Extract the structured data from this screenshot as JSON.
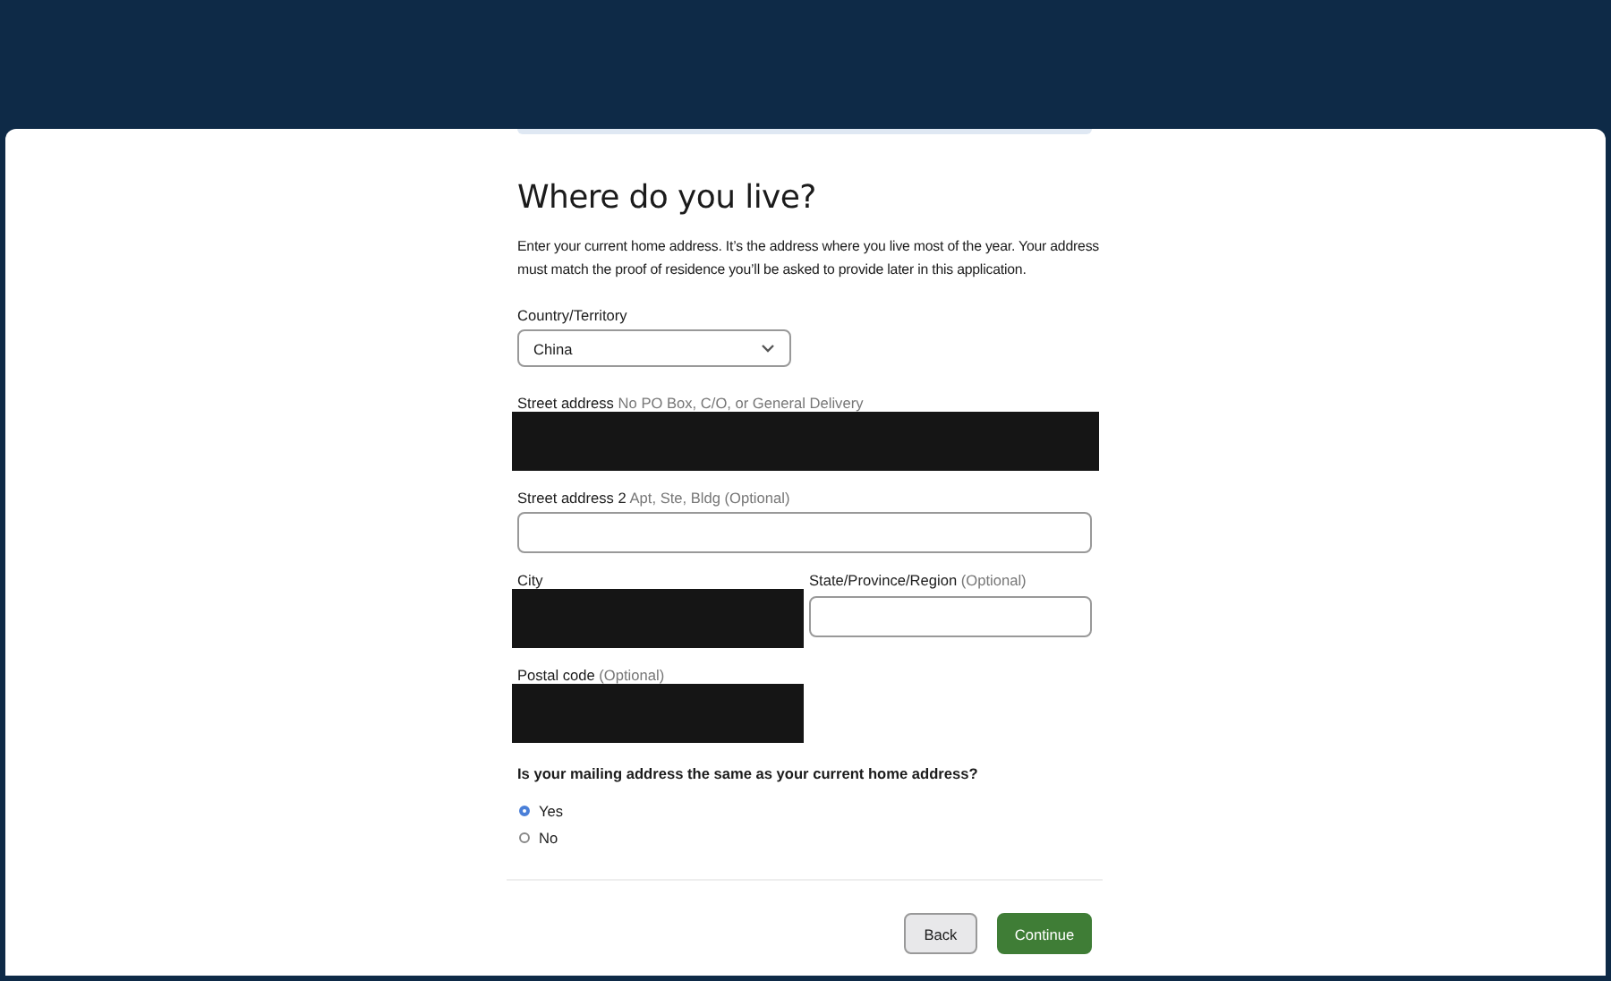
{
  "heading": "Where do you live?",
  "intro": "Enter your current home address. It’s the address where you live most of the year. Your address must match the proof of residence you’ll be asked to provide later in this application.",
  "country": {
    "label": "Country/Territory",
    "value": "China"
  },
  "fields": [
    {
      "label": "Street address",
      "hint": "No PO Box, C/O, or General Delivery",
      "kind": "redacted"
    },
    {
      "label": "Street address 2",
      "hint": "Apt, Ste, Bldg (Optional)",
      "kind": "text"
    },
    {
      "label": "City",
      "kind": "redacted"
    },
    {
      "label": "State/Province/Region",
      "hint": "(Optional)",
      "kind": "text"
    },
    {
      "label": "Postal code",
      "hint": "(Optional)",
      "kind": "redacted"
    }
  ],
  "mailing": {
    "question": "Is your mailing address the same as your current home address?",
    "options": [
      {
        "label": "Yes",
        "selected": true
      },
      {
        "label": "No",
        "selected": false
      }
    ]
  },
  "buttons": [
    {
      "label": "Back",
      "kind": "secondary"
    },
    {
      "label": "Continue",
      "kind": "primary"
    }
  ]
}
